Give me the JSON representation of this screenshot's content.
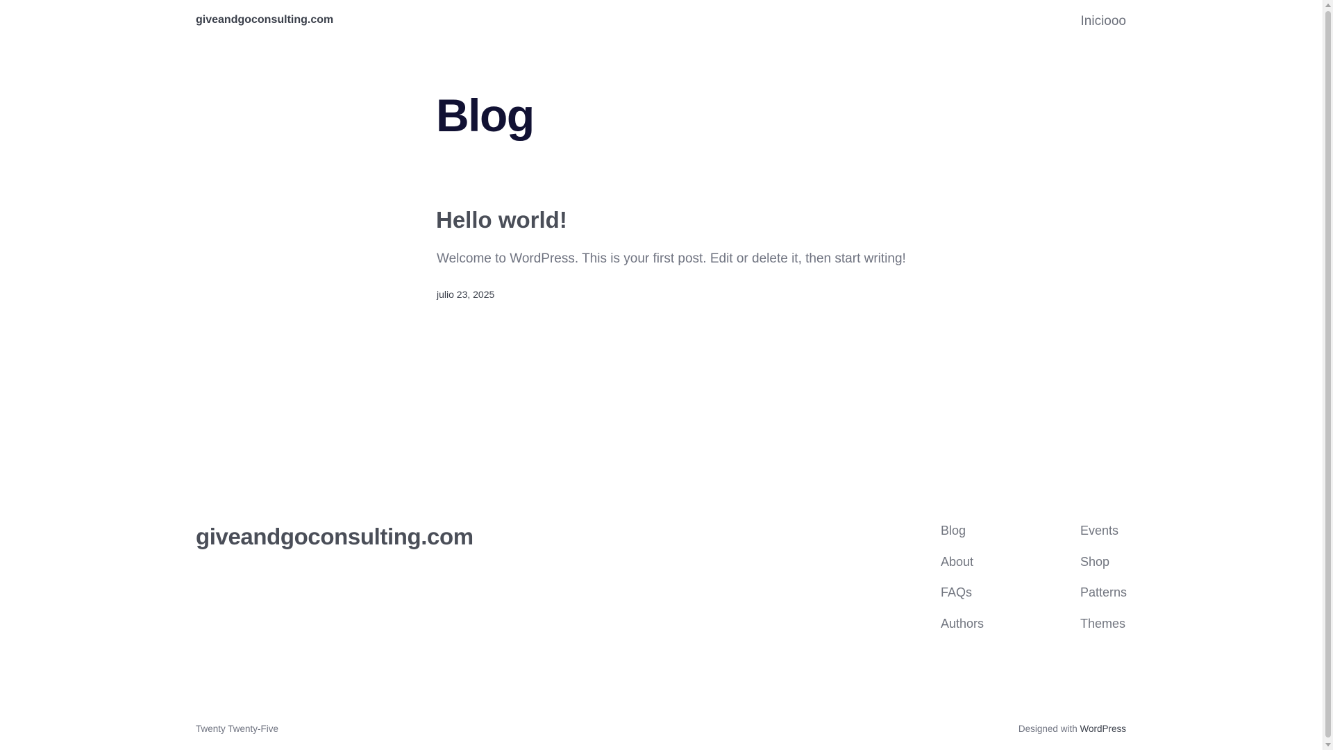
{
  "header": {
    "site_title": "giveandgoconsulting.com",
    "nav": [
      {
        "label": "Iniciooo"
      }
    ]
  },
  "main": {
    "page_title": "Blog",
    "posts": [
      {
        "title": "Hello world!",
        "excerpt": "Welcome to WordPress. This is your first post. Edit or delete it, then start writing!",
        "date": "julio 23, 2025"
      }
    ]
  },
  "footer": {
    "site_title": "giveandgoconsulting.com",
    "nav_columns": [
      [
        {
          "label": "Blog"
        },
        {
          "label": "About"
        },
        {
          "label": "FAQs"
        },
        {
          "label": "Authors"
        }
      ],
      [
        {
          "label": "Events"
        },
        {
          "label": "Shop"
        },
        {
          "label": "Patterns"
        },
        {
          "label": "Themes"
        }
      ]
    ],
    "theme_credit": "Twenty Twenty-Five",
    "designed_with_text": "Designed with",
    "designed_with_link": "WordPress"
  },
  "colors": {
    "heading": "#111133",
    "text": "#4a4e58",
    "muted": "#6f7380",
    "background": "#ffffff"
  }
}
